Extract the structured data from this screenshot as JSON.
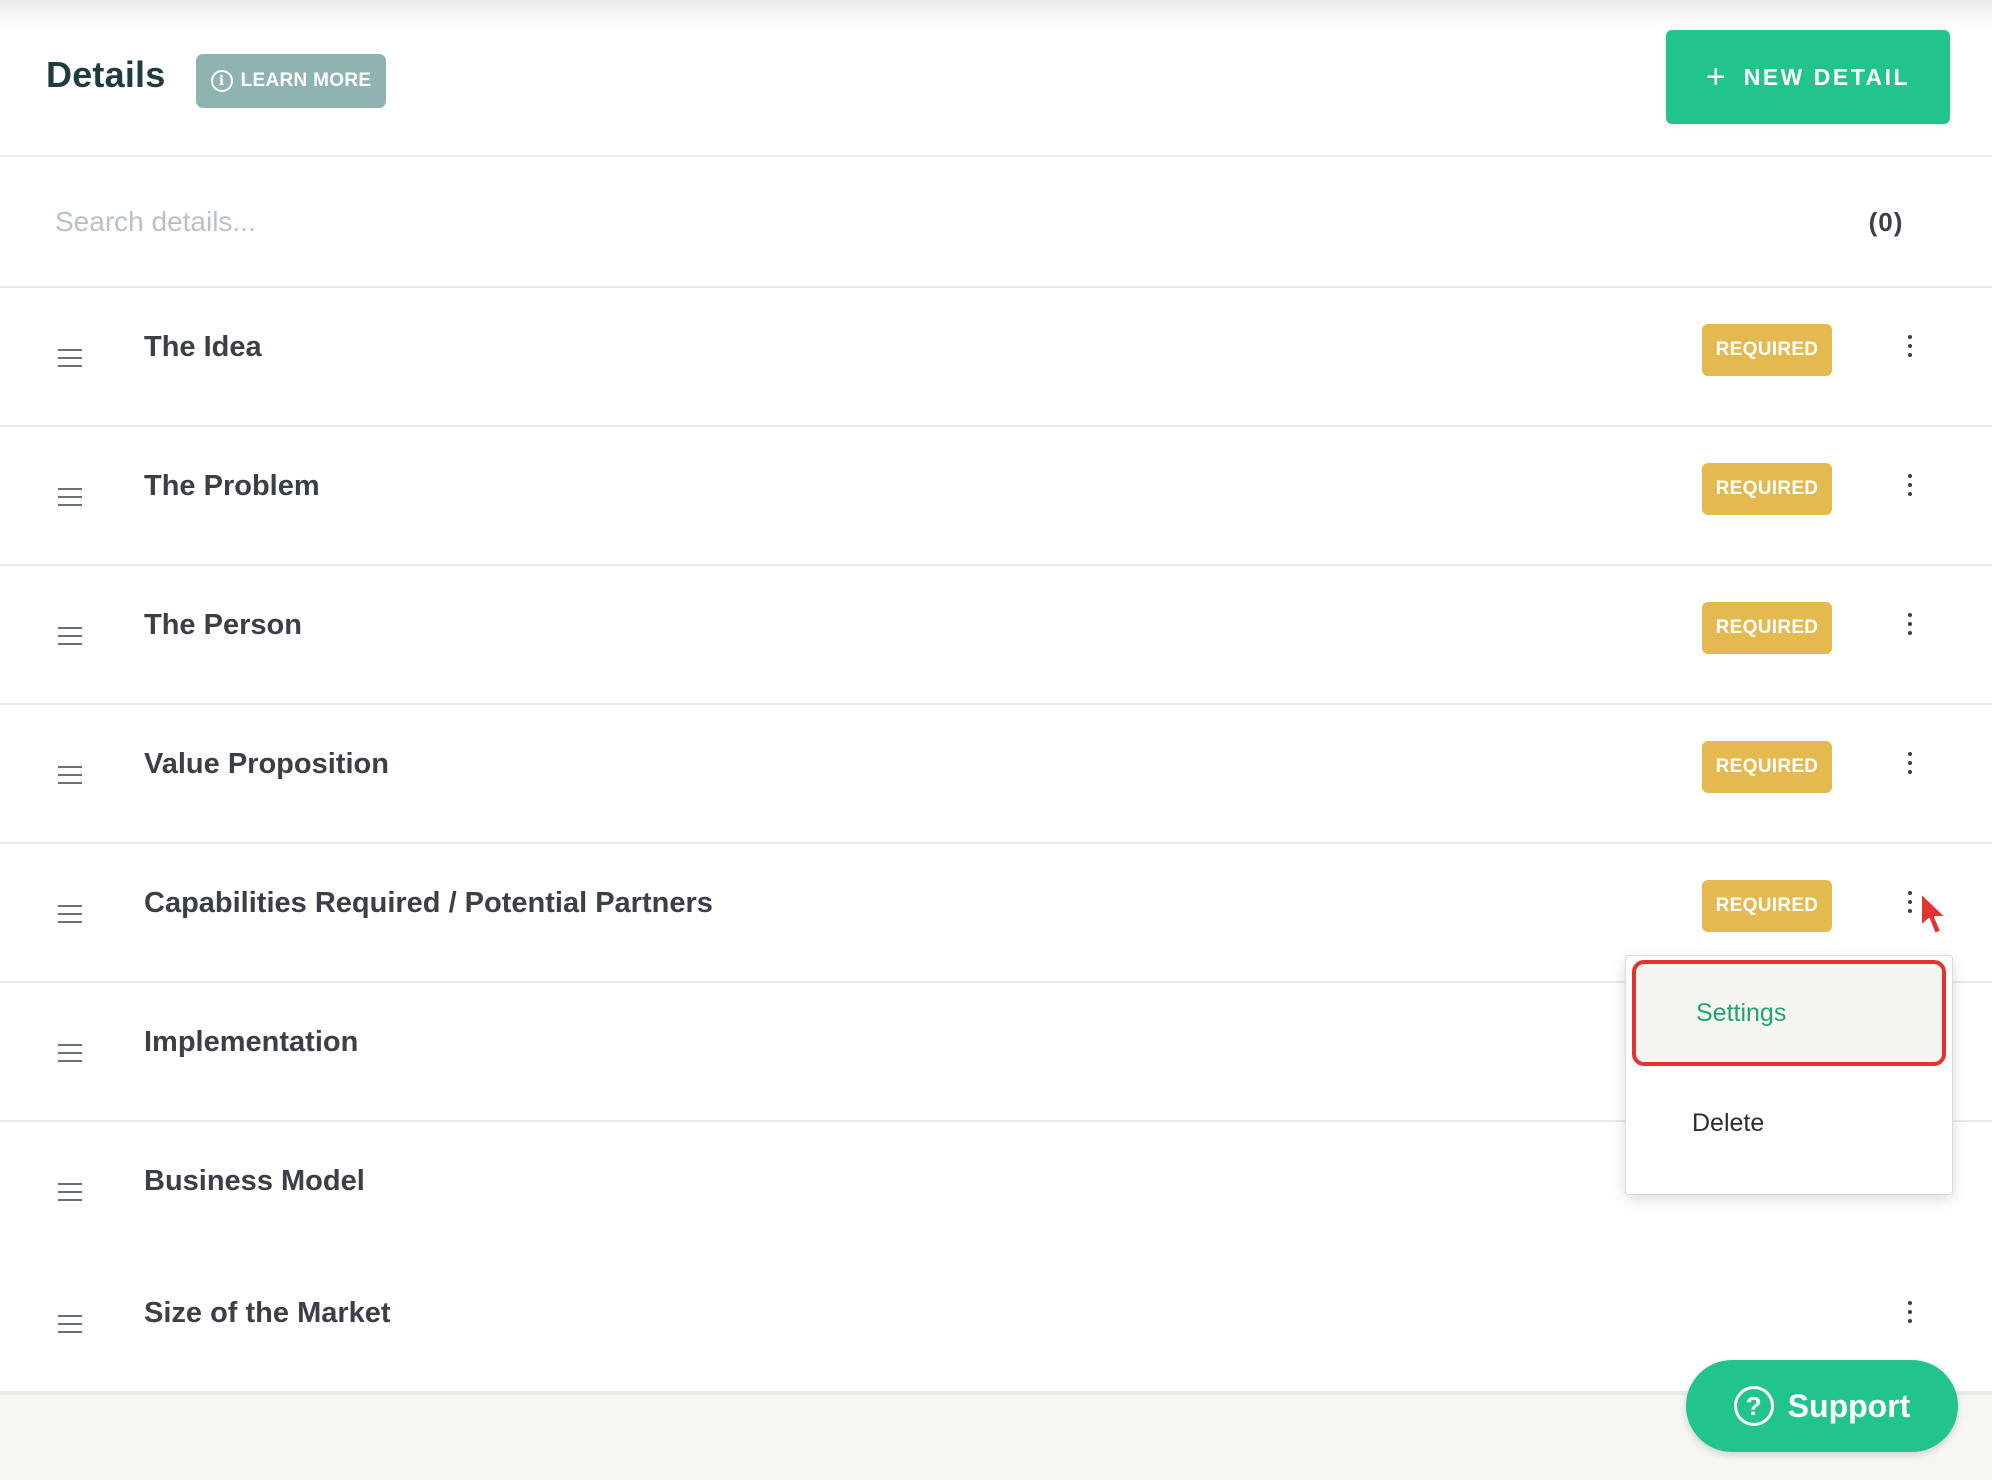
{
  "header": {
    "title": "Details",
    "learn_more_label": "LEARN MORE",
    "new_detail_label": "NEW DETAIL"
  },
  "search": {
    "placeholder": "Search details...",
    "value": "",
    "count": "(0)"
  },
  "details": [
    {
      "title": "The Idea",
      "badge": "REQUIRED"
    },
    {
      "title": "The Problem",
      "badge": "REQUIRED"
    },
    {
      "title": "The Person",
      "badge": "REQUIRED"
    },
    {
      "title": "Value Proposition",
      "badge": "REQUIRED"
    },
    {
      "title": "Capabilities Required / Potential Partners",
      "badge": "REQUIRED"
    },
    {
      "title": "Implementation",
      "badge": ""
    },
    {
      "title": "Business Model",
      "badge": ""
    },
    {
      "title": "Size of the Market",
      "badge": ""
    }
  ],
  "context_menu": {
    "items": [
      "Settings",
      "Delete"
    ],
    "highlighted": "Settings"
  },
  "support": {
    "label": "Support"
  },
  "colors": {
    "accent": "#21c48b",
    "badge": "#e4b94f",
    "learn_more": "#8fb3b1",
    "highlight_outline": "#e5322e"
  },
  "icons": {
    "learn_more": "info-icon",
    "new_detail": "plus-icon",
    "row_drag": "drag-handle-icon",
    "row_menu": "more-vertical-icon",
    "support": "help-circle-icon"
  }
}
